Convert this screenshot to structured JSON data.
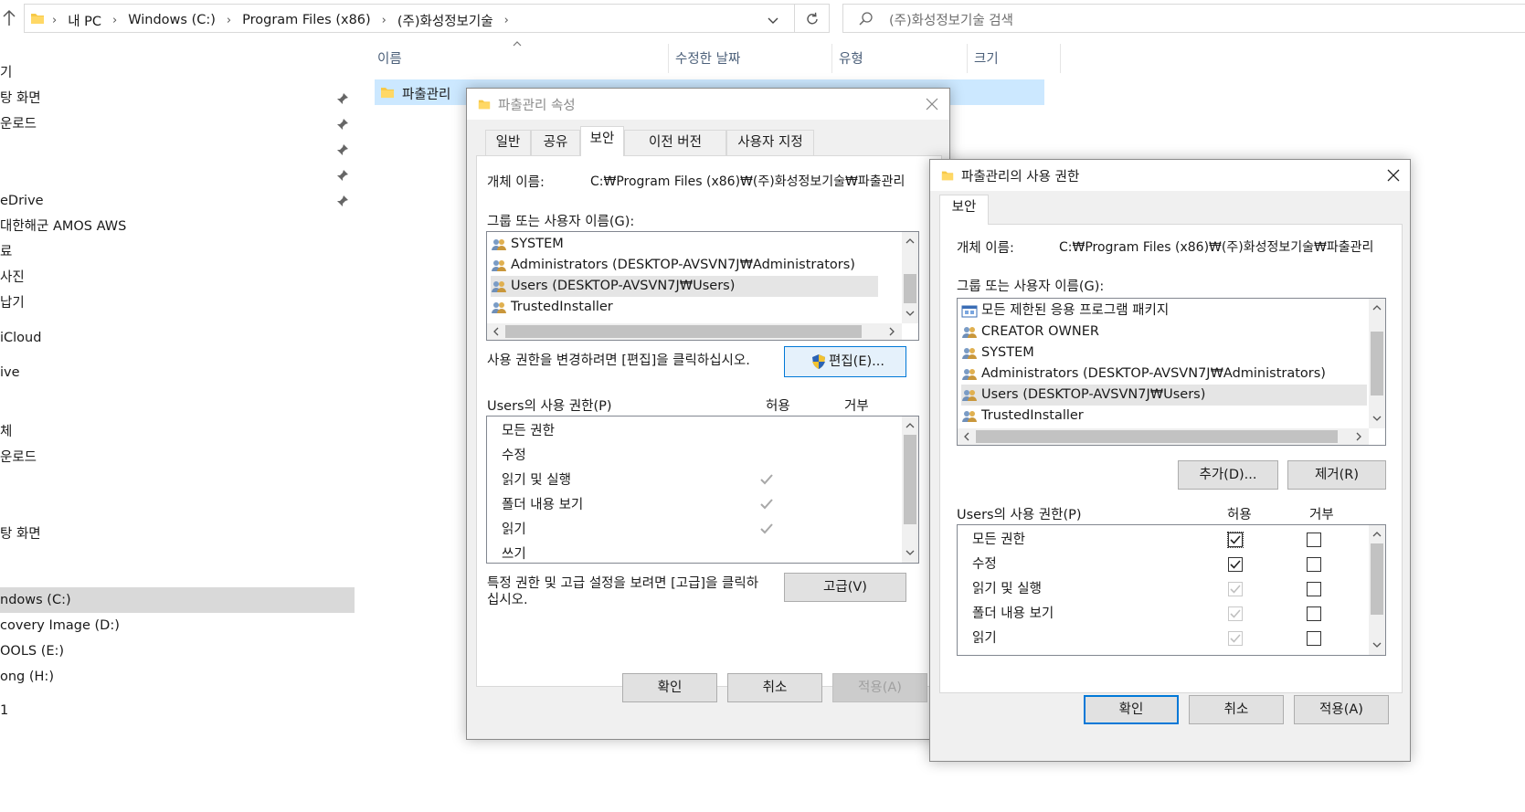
{
  "address_bar": {
    "crumbs": [
      "내 PC",
      "Windows (C:)",
      "Program Files (x86)",
      "(주)화성정보기술"
    ],
    "search_placeholder": "(주)화성정보기술 검색"
  },
  "nav": {
    "items": [
      "기",
      "탕 화면",
      "운로드",
      "",
      "",
      "eDrive",
      "대한해군 AMOS AWS",
      "료",
      "사진",
      "납기",
      "iCloud",
      "ive",
      "",
      "체",
      "운로드",
      "",
      "",
      "탕 화면",
      "",
      "ndows (C:)",
      "covery Image (D:)",
      "OOLS (E:)",
      "ong (H:)",
      "1"
    ],
    "selected_index": 19
  },
  "file_list": {
    "columns": [
      "이름",
      "수정한 날짜",
      "유형",
      "크기"
    ],
    "row_name": "파출관리"
  },
  "props_dialog": {
    "title": "파출관리 속성",
    "tabs": [
      "일반",
      "공유",
      "보안",
      "이전 버전",
      "사용자 지정"
    ],
    "active_tab": 2,
    "object_label": "개체 이름:",
    "object_value": "C:₩Program Files (x86)₩(주)화성정보기술₩파출관리",
    "group_label": "그룹 또는 사용자 이름(G):",
    "users": [
      "SYSTEM",
      "Administrators (DESKTOP-AVSVN7J₩Administrators)",
      "Users (DESKTOP-AVSVN7J₩Users)",
      "TrustedInstaller"
    ],
    "selected_user": 2,
    "edit_hint": "사용 권한을 변경하려면 [편집]을 클릭하십시오.",
    "edit_button": "편집(E)...",
    "perm_label": "Users의 사용 권한(P)",
    "allow_header": "허용",
    "deny_header": "거부",
    "permissions": [
      "모든 권한",
      "수정",
      "읽기 및 실행",
      "폴더 내용 보기",
      "읽기",
      "쓰기"
    ],
    "allowed": [
      false,
      false,
      true,
      true,
      true,
      false
    ],
    "advanced_hint_1": "특정 권한 및 고급 설정을 보려면 [고급]을 클릭하",
    "advanced_hint_2": "십시오.",
    "advanced_button": "고급(V)",
    "ok": "확인",
    "cancel": "취소",
    "apply": "적용(A)"
  },
  "perm_dialog": {
    "title": "파출관리의 사용 권한",
    "tab": "보안",
    "object_label": "개체 이름:",
    "object_value": "C:₩Program Files (x86)₩(주)화성정보기술₩파출관리",
    "group_label": "그룹 또는 사용자 이름(G):",
    "users": [
      "모든 제한된 응용 프로그램 패키지",
      "CREATOR OWNER",
      "SYSTEM",
      "Administrators (DESKTOP-AVSVN7J₩Administrators)",
      "Users (DESKTOP-AVSVN7J₩Users)",
      "TrustedInstaller"
    ],
    "selected_user": 4,
    "add_button": "추가(D)...",
    "remove_button": "제거(R)",
    "perm_label": "Users의 사용 권한(P)",
    "allow_header": "허용",
    "deny_header": "거부",
    "permissions": [
      "모든 권한",
      "수정",
      "읽기 및 실행",
      "폴더 내용 보기",
      "읽기"
    ],
    "allow_checked": [
      true,
      true,
      true,
      true,
      true
    ],
    "allow_disabled": [
      false,
      false,
      true,
      true,
      true
    ],
    "deny_checked": [
      false,
      false,
      false,
      false,
      false
    ],
    "ok": "확인",
    "cancel": "취소",
    "apply": "적용(A)"
  }
}
